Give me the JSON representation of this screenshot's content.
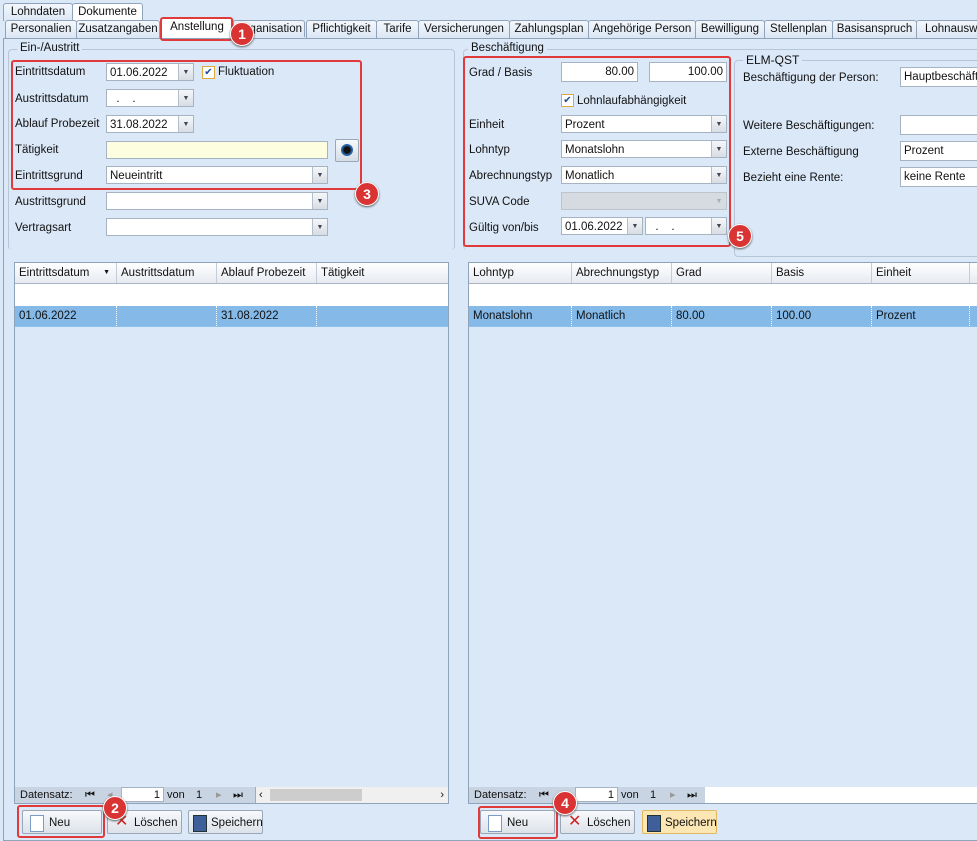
{
  "top_tabs": [
    "Lohndaten",
    "Dokumente"
  ],
  "tabs": [
    "Personalien",
    "Zusatzangaben",
    "Anstellung",
    "Organisation",
    "Pflichtigkeit",
    "Tarife",
    "Versicherungen",
    "Zahlungsplan",
    "Angehörige Person",
    "Bewilligung",
    "Stellenplan",
    "Basisanspruch",
    "Lohnausweis"
  ],
  "left": {
    "group_title": "Ein-/Austritt",
    "eintrittsdatum": {
      "label": "Eintrittsdatum",
      "value": "01.06.2022"
    },
    "fluktuation": {
      "label": "Fluktuation",
      "checked": true
    },
    "austrittsdatum": {
      "label": "Austrittsdatum",
      "value": "  .    ."
    },
    "probezeit": {
      "label": "Ablauf Probezeit",
      "value": "31.08.2022"
    },
    "taetigkeit": {
      "label": "Tätigkeit",
      "value": ""
    },
    "eintrittsgrund": {
      "label": "Eintrittsgrund",
      "value": "Neueintritt"
    },
    "austrittsgrund": {
      "label": "Austrittsgrund",
      "value": ""
    },
    "vertragsart": {
      "label": "Vertragsart",
      "value": ""
    },
    "grid": {
      "columns": [
        "Eintrittsdatum",
        "Austrittsdatum",
        "Ablauf Probezeit",
        "Tätigkeit"
      ],
      "rows": [
        [
          "01.06.2022",
          "",
          "31.08.2022",
          ""
        ]
      ]
    },
    "nav": {
      "label": "Datensatz:",
      "page": "1",
      "of": "von",
      "total": "1"
    },
    "buttons": {
      "new": "Neu",
      "delete": "Löschen",
      "save": "Speichern"
    }
  },
  "right": {
    "group_title": "Beschäftigung",
    "grad_basis": {
      "label": "Grad / Basis",
      "grad": "80.00",
      "basis": "100.00"
    },
    "lohnlauf": {
      "label": "Lohnlaufabhängigkeit",
      "checked": true
    },
    "einheit": {
      "label": "Einheit",
      "value": "Prozent"
    },
    "lohntyp": {
      "label": "Lohntyp",
      "value": "Monatslohn"
    },
    "abrechnungstyp": {
      "label": "Abrechnungstyp",
      "value": "Monatlich"
    },
    "suva": {
      "label": "SUVA Code",
      "value": ""
    },
    "gueltig": {
      "label": "Gültig von/bis",
      "from": "01.06.2022",
      "to": "  .    ."
    },
    "grid": {
      "columns": [
        "Lohntyp",
        "Abrechnungstyp",
        "Grad",
        "Basis",
        "Einheit",
        ""
      ],
      "rows": [
        [
          "Monatslohn",
          "Monatlich",
          "80.00",
          "100.00",
          "Prozent",
          ""
        ]
      ]
    },
    "nav": {
      "label": "Datensatz:",
      "page": "1",
      "of": "von",
      "total": "1"
    },
    "buttons": {
      "new": "Neu",
      "delete": "Löschen",
      "save": "Speichern"
    }
  },
  "elm": {
    "title": "ELM-QST",
    "beschaeftigung": {
      "label": "Beschäftigung der Person:",
      "value": "Hauptbeschäftigung"
    },
    "weitere": {
      "label": "Weitere Beschäftigungen:",
      "value": ""
    },
    "extern": {
      "label": "Externe Beschäftigung",
      "value": "Prozent"
    },
    "rente": {
      "label": "Bezieht eine Rente:",
      "value": "keine Rente"
    }
  },
  "badges": [
    "1",
    "2",
    "3",
    "4",
    "5"
  ]
}
